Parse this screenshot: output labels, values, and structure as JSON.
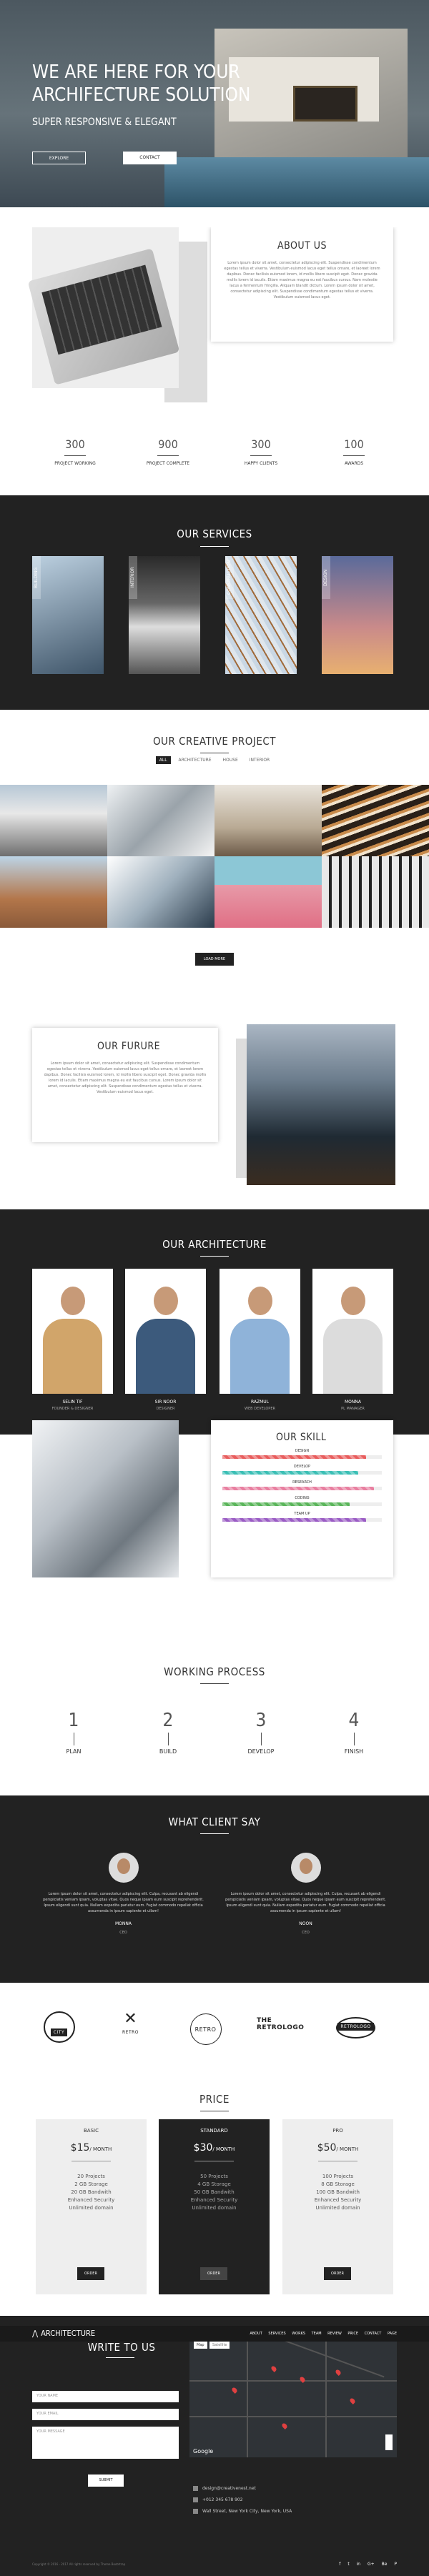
{
  "hero": {
    "title": "WE ARE HERE FOR YOUR ARCHIFECTURE SOLUTION",
    "subtitle": "SUPER RESPONSIVE & ELEGANT",
    "btn_explore": "EXPLORE",
    "btn_contact": "CONTACT"
  },
  "about": {
    "title": "ABOUT US",
    "text": "Lorem ipsum dolor sit amet, consectetur adipiscing elit. Suspendisse condimentum egestas tellus et viverra. Vestibulum euismod lacus eget tellus ornare, et laoreet lorem dapibus. Donec facilisis euismod lorem, id mollis libero suscipit eget. Donec gravida mollis lorem id iaculis. Etiam maximus magna eu est faucibus cursus. Nam molestie lacus a fermentum fringilla. Aliquam blandit dictum. Lorem ipsum dolor sit amet, consectetur adipiscing elit. Suspendisse condimentum egestas tellus et viverra. Vestibulum euismod lacus eget."
  },
  "counters": [
    {
      "n": "300",
      "l": "PROJECT WORKING"
    },
    {
      "n": "900",
      "l": "PROJECT COMPLETE"
    },
    {
      "n": "300",
      "l": "HAPPY CLIENTS"
    },
    {
      "n": "100",
      "l": "AWARDS"
    }
  ],
  "services": {
    "title": "OUR SERVICES",
    "items": [
      "BUILDING",
      "INTERIOR",
      "CONSTRUCTION",
      "DESIGN"
    ]
  },
  "project": {
    "title": "OUR CREATIVE PROJECT",
    "tabs": [
      "ALL",
      "ARCHITECTURE",
      "HOUSE",
      "INTERIOR"
    ],
    "load_more": "LOAD MORE"
  },
  "future": {
    "title": "OUR FURURE",
    "text": "Lorem ipsum dolor sit amet, consectetur adipiscing elit. Suspendisse condimentum egestas tellus et viverra. Vestibulum euismod lacus eget tellus ornare, et laoreet lorem dapibus. Donec facilisis euismod lorem, id mollis libero suscipit eget. Donec gravida mollis lorem id iaculis. Etiam maximus magna eu est faucibus cursus. Lorem ipsum dolor sit amet, consectetur adipiscing elit. Suspendisse condimentum egestas tellus et viverra. Vestibulum euismod lacus eget."
  },
  "team": {
    "title": "OUR ARCHITECTURE",
    "members": [
      {
        "name": "SELIN TIF",
        "role": "FOUNDER & DESIGNER",
        "shirt": "#d1a56a"
      },
      {
        "name": "SIR NOOR",
        "role": "DESIGNER",
        "shirt": "#3c5a7c"
      },
      {
        "name": "RAZMUL",
        "role": "WEB DEVELOPER",
        "shirt": "#8fb3d9"
      },
      {
        "name": "MONNA",
        "role": "PL MANAGER",
        "shirt": "#e8e8e8"
      }
    ]
  },
  "skill": {
    "title": "OUR SKILL",
    "bars": [
      {
        "name": "DESIGN",
        "pct": 0.9,
        "color": "#e85d5d"
      },
      {
        "name": "DEVELOP",
        "pct": 0.85,
        "color": "#3bbfb5"
      },
      {
        "name": "RESEARCH",
        "pct": 0.95,
        "color": "#e87fa0"
      },
      {
        "name": "CODING",
        "pct": 0.8,
        "color": "#5ab55a"
      },
      {
        "name": "TEAM UP",
        "pct": 0.9,
        "color": "#9a5cc4"
      }
    ]
  },
  "process": {
    "title": "WORKING PROCESS",
    "steps": [
      {
        "n": "1",
        "l": "PLAN"
      },
      {
        "n": "2",
        "l": "BUILD"
      },
      {
        "n": "3",
        "l": "DEVELOP"
      },
      {
        "n": "4",
        "l": "FINISH"
      }
    ]
  },
  "client": {
    "title": "WHAT CLIENT SAY",
    "items": [
      {
        "text": "Lorem ipsum dolor sit amet, consectetur adipiscing elit. Culpa, recusant ab eligendi perspiciatis veniam ipsam, voluptas vitae. Quos neque ipsam eum suscipit reprehenderit. Ipsum eligendi sunt quia. Nullam expedita pariatur eum. Fugiat commodo repellat officia assumenda in ipsum sapiente et ullam!",
        "name": "MONNA",
        "role": "CEO"
      },
      {
        "text": "Lorem ipsum dolor sit amet, consectetur adipiscing elit. Culpa, recusant ab eligendi perspiciatis veniam ipsam, voluptas vitae. Quos neque ipsam eum suscipit reprehenderit. Ipsum eligendi sunt quia. Nullam expedita pariatur eum. Fugiat commodo repellat officia assumenda in ipsum sapiente et ullam!",
        "name": "NOON",
        "role": "CEO"
      }
    ]
  },
  "logos": [
    "CITY",
    "RETRO",
    "RETRO",
    "THE RETROLOGO",
    "RETROLOGO"
  ],
  "pricing": {
    "title": "PRICE",
    "plans": [
      {
        "name": "BASIC",
        "price": "$15",
        "per": "/ MONTH",
        "features": [
          "20 Projects",
          "2 GB Storage",
          "20 GB Bandwith",
          "Enhanced Security",
          "Unlimited domain"
        ],
        "btn": "ORDER"
      },
      {
        "name": "STANDARD",
        "price": "$30",
        "per": "/ MONTH",
        "features": [
          "50 Projects",
          "4 GB Storage",
          "50 GB Bandwith",
          "Enhanced Security",
          "Unlimited domain"
        ],
        "btn": "ORDER"
      },
      {
        "name": "PRO",
        "price": "$50",
        "per": "/ MONTH",
        "features": [
          "100 Projects",
          "8 GB Storage",
          "100 GB Bandwith",
          "Enhanced Security",
          "Unlimited domain"
        ],
        "btn": "ORDER"
      }
    ]
  },
  "contact": {
    "title": "WRITE TO US",
    "name_ph": "YOUR NAME",
    "email_ph": "YOUR EMAIL",
    "msg_ph": "YOUR MESSAGE",
    "submit": "SUBMIT",
    "map_btn": "Map",
    "sat_btn": "Satellite",
    "google": "Google",
    "email": "design@creativenest.net",
    "phone": "+012 345 678 902",
    "address": "Wall Street, New York City, New York, USA"
  },
  "nav": {
    "brand": "ARCHITECTURE",
    "items": [
      "ABOUT",
      "SERVICES",
      "WORKS",
      "TEAM",
      "REVIEW",
      "PRICE",
      "CONTACT",
      "PAGE"
    ]
  },
  "footer": {
    "copyright": "Copyright © 2016 - 2017 All rights reserved by Theme Bootstrap",
    "social": [
      "f",
      "t",
      "in",
      "G+",
      "Be",
      "P"
    ]
  }
}
